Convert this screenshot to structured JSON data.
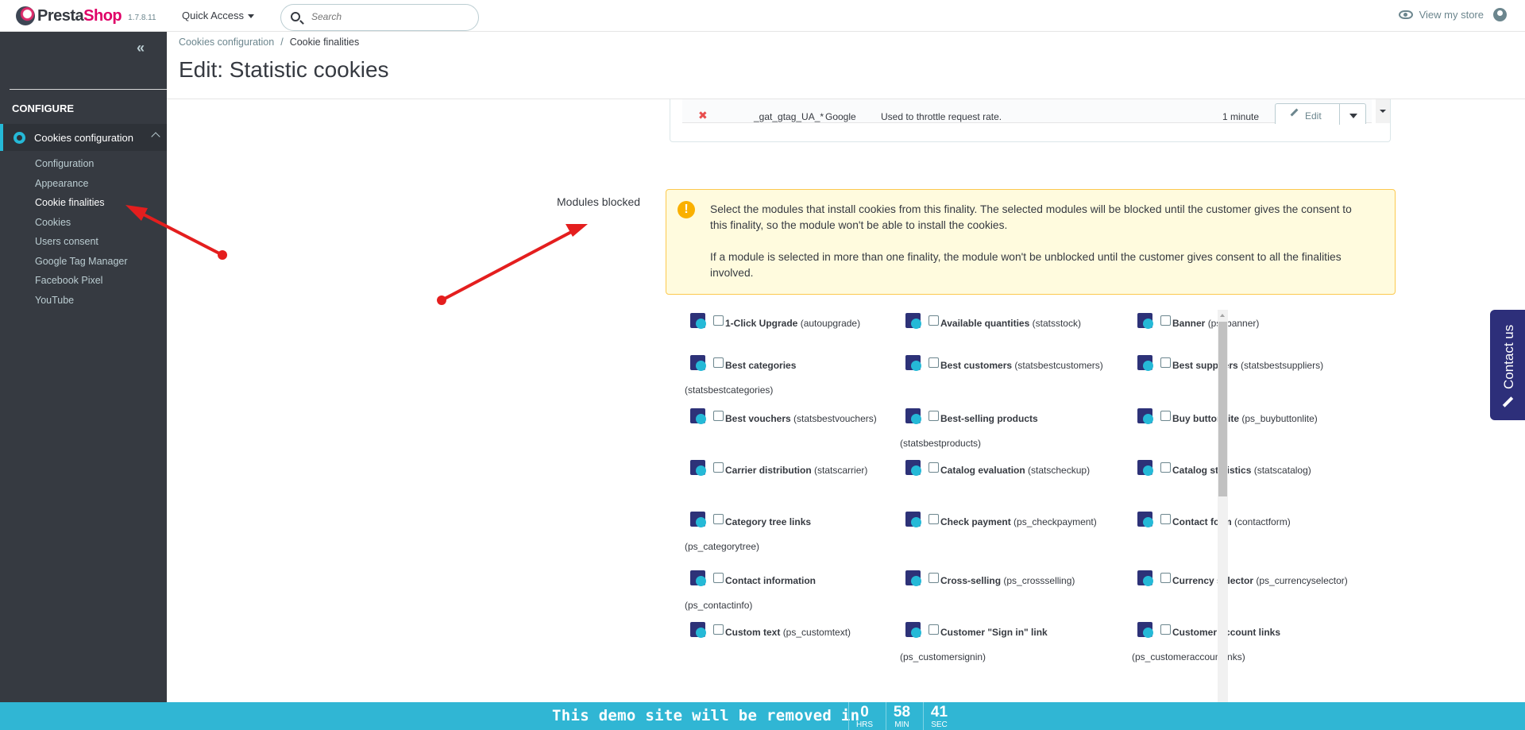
{
  "app": {
    "brand_pre": "Presta",
    "brand_post": "Shop",
    "version": "1.7.8.11",
    "quick_access": "Quick Access",
    "search_placeholder": "Search",
    "view_store": "View my store"
  },
  "sidebar": {
    "section": "CONFIGURE",
    "main_item": "Cookies configuration",
    "items": [
      {
        "label": "Configuration",
        "active": false
      },
      {
        "label": "Appearance",
        "active": false
      },
      {
        "label": "Cookie finalities",
        "active": true
      },
      {
        "label": "Cookies",
        "active": false
      },
      {
        "label": "Users consent",
        "active": false
      },
      {
        "label": "Google Tag Manager",
        "active": false
      },
      {
        "label": "Facebook Pixel",
        "active": false
      },
      {
        "label": "YouTube",
        "active": false
      }
    ]
  },
  "header": {
    "breadcrumb_1": "Cookies configuration",
    "breadcrumb_sep": "/",
    "breadcrumb_2": "Cookie finalities",
    "title": "Edit: Statistic cookies"
  },
  "cookie_row": {
    "name": "_gat_gtag_UA_*",
    "provider": "Google",
    "purpose": "Used to throttle request rate.",
    "expiry": "1 minute",
    "edit_label": "Edit"
  },
  "modules_section": {
    "label": "Modules blocked",
    "alert_p1": "Select the modules that install cookies from this finality. The selected modules will be blocked until the customer gives the consent to this finality, so the module won't be able to install the cookies.",
    "alert_p2": "If a module is selected in more than one finality, the module won't be unblocked until the customer gives consent to all the finalities involved.",
    "modules": [
      {
        "name": "1-Click Upgrade",
        "tech": "(autoupgrade)",
        "wrap": false
      },
      {
        "name": "Available quantities",
        "tech": "(statsstock)",
        "wrap": false
      },
      {
        "name": "Banner",
        "tech": "(ps_banner)",
        "wrap": false
      },
      {
        "name": "Best categories",
        "tech": "(statsbestcategories)",
        "wrap": true
      },
      {
        "name": "Best customers",
        "tech": "(statsbestcustomers)",
        "wrap": false
      },
      {
        "name": "Best suppliers",
        "tech": "(statsbestsuppliers)",
        "wrap": false
      },
      {
        "name": "Best vouchers",
        "tech": "(statsbestvouchers)",
        "wrap": false
      },
      {
        "name": "Best-selling products",
        "tech": "(statsbestproducts)",
        "wrap": true
      },
      {
        "name": "Buy button lite",
        "tech": "(ps_buybuttonlite)",
        "wrap": false
      },
      {
        "name": "Carrier distribution",
        "tech": "(statscarrier)",
        "wrap": false
      },
      {
        "name": "Catalog evaluation",
        "tech": "(statscheckup)",
        "wrap": false
      },
      {
        "name": "Catalog statistics",
        "tech": "(statscatalog)",
        "wrap": false
      },
      {
        "name": "Category tree links",
        "tech": "(ps_categorytree)",
        "wrap": true
      },
      {
        "name": "Check payment",
        "tech": "(ps_checkpayment)",
        "wrap": false
      },
      {
        "name": "Contact form",
        "tech": "(contactform)",
        "wrap": false
      },
      {
        "name": "Contact information",
        "tech": "(ps_contactinfo)",
        "wrap": true
      },
      {
        "name": "Cross-selling",
        "tech": "(ps_crossselling)",
        "wrap": false
      },
      {
        "name": "Currency selector",
        "tech": "(ps_currencyselector)",
        "wrap": false
      },
      {
        "name": "Custom text",
        "tech": "(ps_customtext)",
        "wrap": false
      },
      {
        "name": "Customer \"Sign in\" link",
        "tech": "(ps_customersignin)",
        "wrap": true
      },
      {
        "name": "Customer account links",
        "tech": "(ps_customeraccountlinks)",
        "wrap": true
      }
    ]
  },
  "contact_tab": "Contact us",
  "demo_banner": {
    "message": "This demo site will be removed in",
    "hours": "0",
    "hours_unit": "HRS",
    "minutes": "58",
    "minutes_unit": "MIN",
    "seconds": "41",
    "seconds_unit": "SEC"
  },
  "colors": {
    "accent": "#25b9d7",
    "sidebar_bg": "#363a41",
    "banner_bg": "#30b6d4",
    "annotation_arrow": "#e41e1e"
  }
}
